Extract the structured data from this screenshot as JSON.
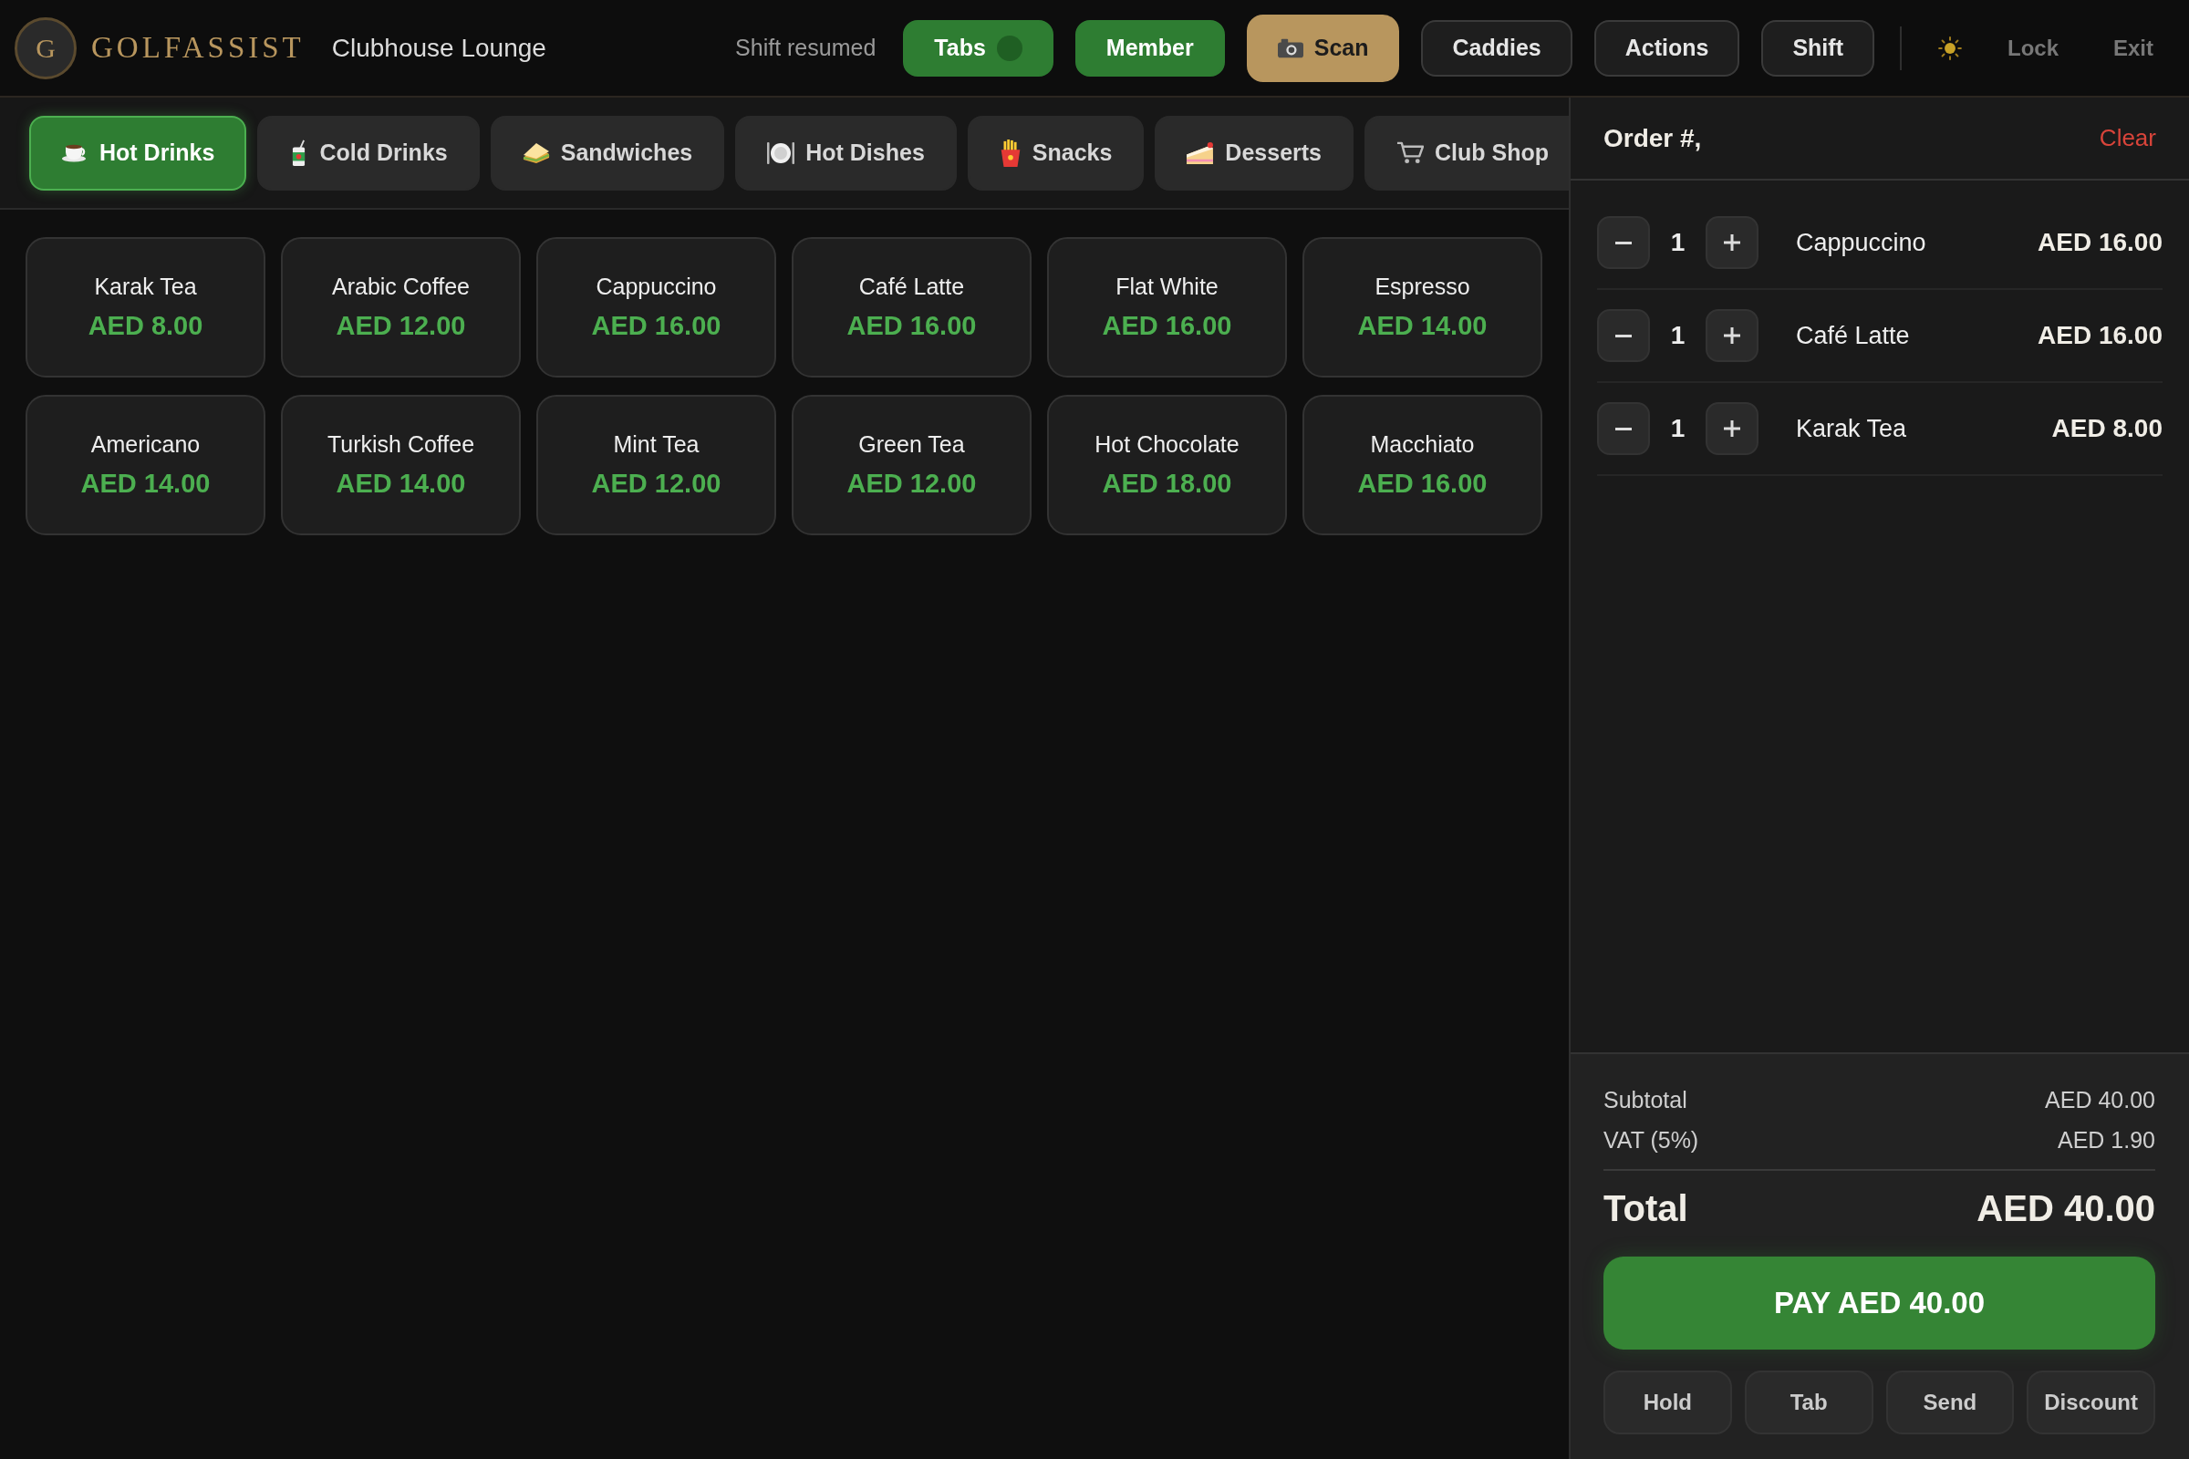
{
  "header": {
    "logo_letter": "G",
    "brand": "GOLFASSIST",
    "location": "Clubhouse Lounge",
    "status": "Shift resumed",
    "buttons": [
      {
        "label": "Tabs",
        "kind": "toggle"
      },
      {
        "label": "Member",
        "kind": "primary"
      },
      {
        "label": "Scan",
        "kind": "scan"
      },
      {
        "label": "Caddies",
        "kind": "secondary"
      },
      {
        "label": "Actions",
        "kind": "secondary"
      },
      {
        "label": "Shift",
        "kind": "secondary"
      }
    ],
    "links": [
      "Lock",
      "Exit"
    ]
  },
  "categories": [
    {
      "label": "Hot Drinks",
      "selected": true
    },
    {
      "label": "Cold Drinks",
      "selected": false
    },
    {
      "label": "Sandwiches",
      "selected": false
    },
    {
      "label": "Hot Dishes",
      "selected": false
    },
    {
      "label": "Snacks",
      "selected": false
    },
    {
      "label": "Desserts",
      "selected": false
    },
    {
      "label": "Club Shop",
      "selected": false
    }
  ],
  "products": [
    {
      "name": "Karak Tea",
      "price": "AED 8.00"
    },
    {
      "name": "Arabic Coffee",
      "price": "AED 12.00"
    },
    {
      "name": "Cappuccino",
      "price": "AED 16.00"
    },
    {
      "name": "Café Latte",
      "price": "AED 16.00"
    },
    {
      "name": "Flat White",
      "price": "AED 16.00"
    },
    {
      "name": "Espresso",
      "price": "AED 14.00"
    },
    {
      "name": "Americano",
      "price": "AED 14.00"
    },
    {
      "name": "Turkish Coffee",
      "price": "AED 14.00"
    },
    {
      "name": "Mint Tea",
      "price": "AED 12.00"
    },
    {
      "name": "Green Tea",
      "price": "AED 12.00"
    },
    {
      "name": "Hot Chocolate",
      "price": "AED 18.00"
    },
    {
      "name": "Macchiato",
      "price": "AED 16.00"
    }
  ],
  "order": {
    "title": "Order #,",
    "clear": "Clear",
    "items": [
      {
        "qty": "1",
        "name": "Cappuccino",
        "price": "AED 16.00"
      },
      {
        "qty": "1",
        "name": "Café Latte",
        "price": "AED 16.00"
      },
      {
        "qty": "1",
        "name": "Karak Tea",
        "price": "AED 8.00"
      }
    ],
    "summary": [
      {
        "label": "Subtotal",
        "value": "AED 40.00"
      },
      {
        "label": "VAT (5%)",
        "value": "AED 1.90"
      }
    ],
    "total": {
      "label": "Total",
      "value": "AED 40.00"
    },
    "pay": "PAY AED 40.00",
    "actions": [
      "Hold",
      "Tab",
      "Send",
      "Discount"
    ]
  }
}
